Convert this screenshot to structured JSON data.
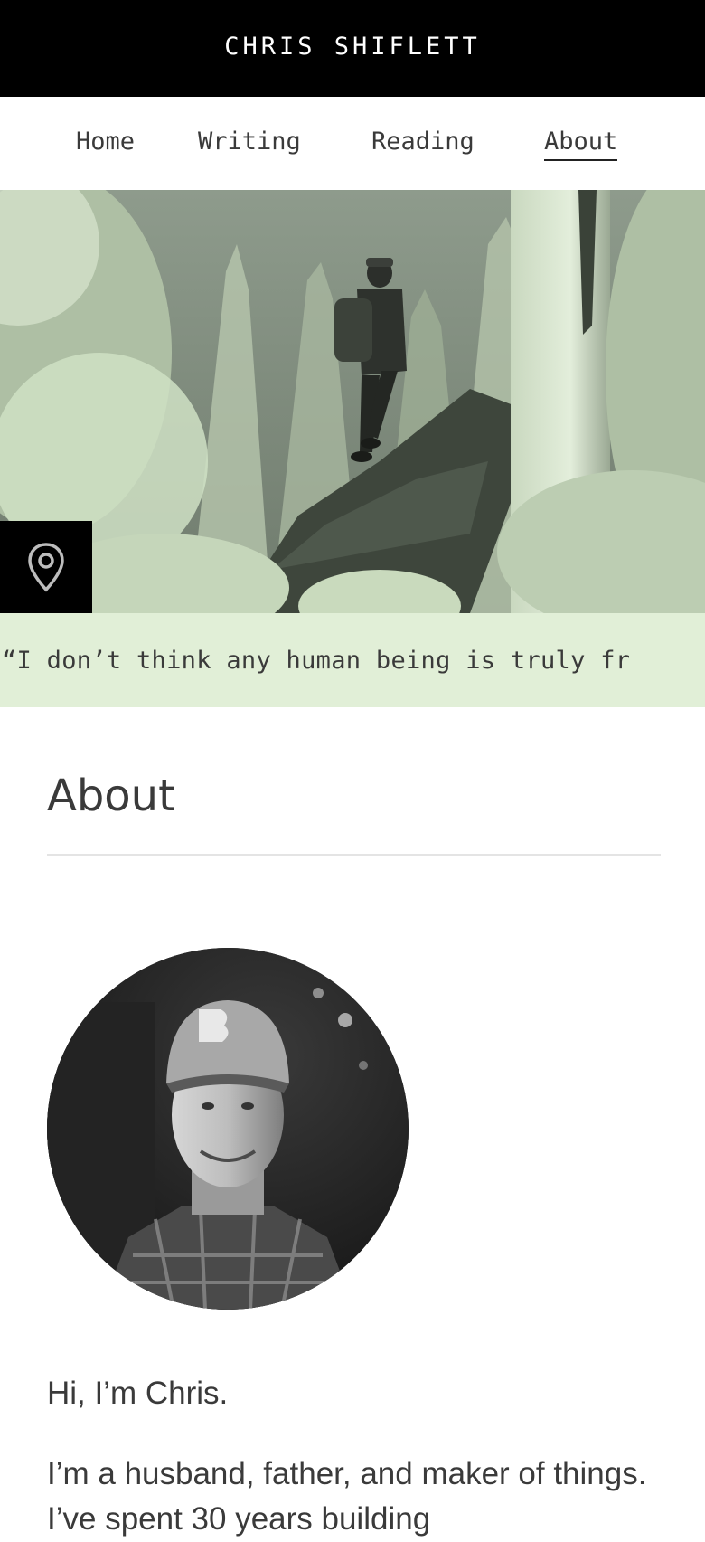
{
  "header": {
    "site_title": "CHRIS SHIFLETT"
  },
  "nav": {
    "items": [
      {
        "label": "Home",
        "active": false
      },
      {
        "label": "Writing",
        "active": false
      },
      {
        "label": "Reading",
        "active": false
      },
      {
        "label": "About",
        "active": true
      }
    ]
  },
  "hero": {
    "location_icon": "map-pin-icon"
  },
  "quote": {
    "text": "“I don’t think any human being is truly fr"
  },
  "main": {
    "title": "About",
    "greeting": "Hi, I’m Chris.",
    "intro": "I’m a husband, father, and maker of things. I’ve spent 30 years building"
  },
  "colors": {
    "header_bg": "#000000",
    "quote_bg": "#e1efd7",
    "text": "#3a3a3a",
    "hero_tint": "#cfe0c4"
  }
}
